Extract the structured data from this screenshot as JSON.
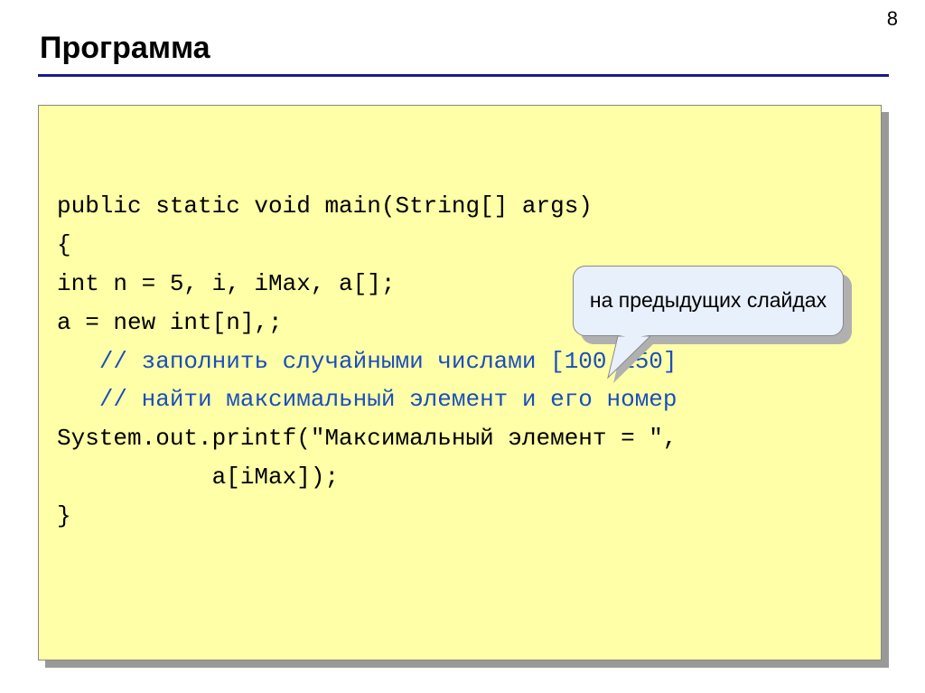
{
  "page_number": "8",
  "title": "Программа",
  "code": {
    "line1": "public static void main(String[] args)",
    "line2": "{",
    "line3": "int n = 5, i, iMax, a[];",
    "line4": "a = new int[n],;",
    "line5_indent": "   ",
    "line5_comment": "// заполнить случайными числами [100,150]",
    "line6_indent": "   ",
    "line6_comment": "// найти максимальный элемент и его номер",
    "line7": "System.out.printf(\"Максимальный элемент = \",",
    "line8": "           a[iMax]);",
    "line9": "}"
  },
  "callout": "на предыдущих слайдах"
}
